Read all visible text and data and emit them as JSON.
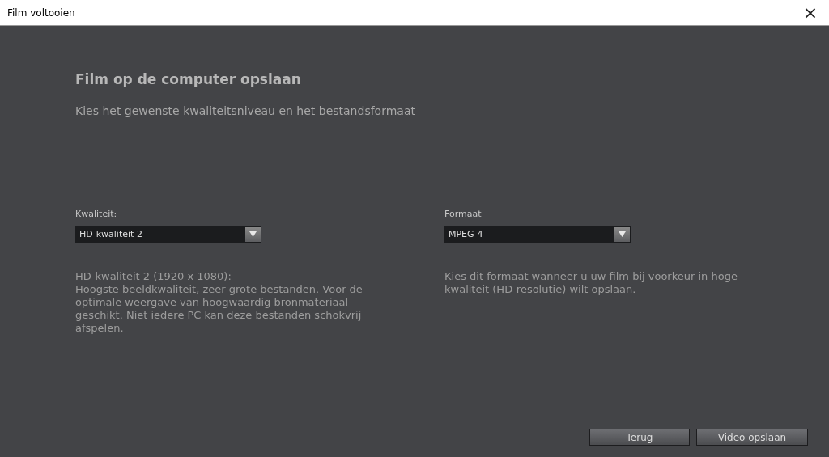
{
  "window": {
    "title": "Film voltooien",
    "close": "×"
  },
  "heading": "Film op de computer opslaan",
  "subtitle": "Kies het gewenste kwaliteitsniveau en het bestandsformaat",
  "settings": [
    {
      "label": "Kwaliteit:",
      "value": "HD-kwaliteit 2",
      "description_title": "HD-kwaliteit 2 (1920 x 1080):",
      "description": "Hoogste beeldkwaliteit, zeer grote bestanden. Voor de optimale weergave van hoogwaardig bronmateriaal geschikt. Niet iedere PC kan deze bestanden schokvrij afspelen."
    },
    {
      "label": "Formaat",
      "value": "MPEG-4",
      "description": "Kies dit formaat wanneer u uw film bij voorkeur in hoge kwaliteit (HD-resolutie) wilt opslaan."
    }
  ],
  "buttons": [
    "Terug",
    "Video opslaan"
  ]
}
